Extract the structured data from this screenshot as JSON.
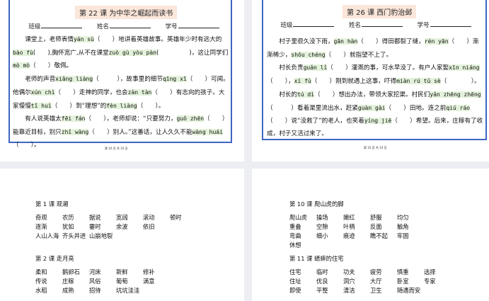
{
  "pages": [
    {
      "title": "第 22 课  为中华之崛起而读书",
      "fields": [
        "班级",
        "姓名",
        "学号"
      ],
      "page_number": "第 10 页 共 10 页",
      "paragraphs": [
        [
          {
            "t": "课堂上，老师表情"
          },
          {
            "p": "yán sù"
          },
          {
            "t": "（　　）地讲着英雄故事。英雄年少时有远大的"
          },
          {
            "p": "bào fù"
          },
          {
            "t": "(　　),胸怀宽广,从不在课堂"
          },
          {
            "p": "zuò gù yòu pàn"
          },
          {
            "t": "(　　　　　)，这让同学们"
          },
          {
            "p": "mò mò"
          },
          {
            "t": "（　　）敬佩。"
          }
        ],
        [
          {
            "t": "老师的声音"
          },
          {
            "p": "xiǎng liàng"
          },
          {
            "t": "（　　　），故事里的细节"
          },
          {
            "p": "qīng xī"
          },
          {
            "t": "（　　）可闻。他偶尔"
          },
          {
            "p": "xún chì"
          },
          {
            "t": "（　　）走神的同学，也会"
          },
          {
            "p": "zàn tàn"
          },
          {
            "t": "（　　）有志向的孩子。大家慢慢"
          },
          {
            "p": "tǐ huì"
          },
          {
            "t": "（　　）到“理想”的"
          },
          {
            "p": "fèn liàng"
          },
          {
            "t": "（　　）。"
          }
        ],
        [
          {
            "t": "有人说英雄太"
          },
          {
            "p": "fēi fán"
          },
          {
            "t": "（　　），老师却说：“只要努力，"
          },
          {
            "p": "guǒ zhēn"
          },
          {
            "t": "（　　）能靠近目标，别只"
          },
          {
            "p": "zhǐ wàng"
          },
          {
            "t": "（　　）别人。”这番话，让人久久不能"
          },
          {
            "p": "wàng huái"
          },
          {
            "t": "（　　）。"
          }
        ]
      ]
    },
    {
      "title": "第 26 课  西门豹治邺",
      "fields": [
        "班级",
        "姓名",
        "学号"
      ],
      "page_number": "第 10 页 共 10 页",
      "paragraphs": [
        [
          {
            "t": "村子里很久没下雨，"
          },
          {
            "p": "gān hàn"
          },
          {
            "t": "（　　）得田都裂了缝，"
          },
          {
            "p": "rén yān"
          },
          {
            "t": "（　　）渐渐稀少，"
          },
          {
            "p": "shōu chéng"
          },
          {
            "t": "（　　）就指望不上了。"
          }
        ],
        [
          {
            "t": "村长负责"
          },
          {
            "p": "guǎn lǐ"
          },
          {
            "t": "（　　）灌溉的事，可水早没了。有户人家娶"
          },
          {
            "p": "xīn niáng"
          },
          {
            "t": "（　　），"
          },
          {
            "p": "xí fù"
          },
          {
            "t": "（　　）刚到就遇上这事，吓得"
          },
          {
            "p": "miàn rú tǔ sè"
          },
          {
            "t": "（　　　　）。"
          }
        ],
        [
          {
            "t": "村长的"
          },
          {
            "p": "tú dì"
          },
          {
            "t": "（　　）想出办法，带领大家挖渠。村民们"
          },
          {
            "p": "yǎn  zhēng zhēng"
          },
          {
            "t": "（　　　）看着渠里流出水，赶紧"
          },
          {
            "p": "guàn gài"
          },
          {
            "t": "（　　）田地。连之前"
          },
          {
            "p": "qiú ráo"
          },
          {
            "t": "（　　）说“没救了”的老人，也笑着"
          },
          {
            "p": "yíng jiē"
          },
          {
            "t": "（　　）希望。后来，庄稼有了收成，村子又活过来了。"
          }
        ]
      ]
    }
  ],
  "lessons_left": [
    {
      "title": "第 1 课  观潮",
      "rows": [
        [
          "奇观",
          "农历",
          "据说",
          "宽阔",
          "滚动",
          "顿时"
        ],
        [
          "逐渐",
          "犹如",
          "霎时",
          "余波",
          "依旧"
        ],
        [
          "人山人海",
          "齐头并进",
          "山崩地裂"
        ]
      ]
    },
    {
      "title": "第 2 课  走月亮",
      "rows": [
        [
          "柔和",
          "鹅卵石",
          "河床",
          "新鲜",
          "修补"
        ],
        [
          "传说",
          "庄稼",
          "风俗",
          "葡萄",
          "满意"
        ],
        [
          "水稻",
          "成熟",
          "招待",
          "坑坑洼洼"
        ]
      ]
    }
  ],
  "lessons_right": [
    {
      "title": "第 10 课  爬山虎的脚",
      "rows": [
        [
          "爬山虎",
          "操场",
          "嫩红",
          "舒服",
          "均匀"
        ],
        [
          "重叠",
          "空隙",
          "叶柄",
          "反面",
          "触角"
        ],
        [
          "弯曲",
          "细小",
          "痕迹",
          "瞧不起",
          "牢固"
        ],
        [
          "休想"
        ]
      ]
    },
    {
      "title": "第 11 课  蟋蟀的住宅",
      "rows": [
        [
          "住宅",
          "临时",
          "功夫",
          "疲劳",
          "慎重",
          "选择"
        ],
        [
          "住址",
          "优良",
          "洞穴",
          "大厅",
          "卧室",
          "专家"
        ],
        [
          "即使",
          "平整",
          "清洁",
          "卫生",
          "随遇而安"
        ]
      ]
    }
  ]
}
